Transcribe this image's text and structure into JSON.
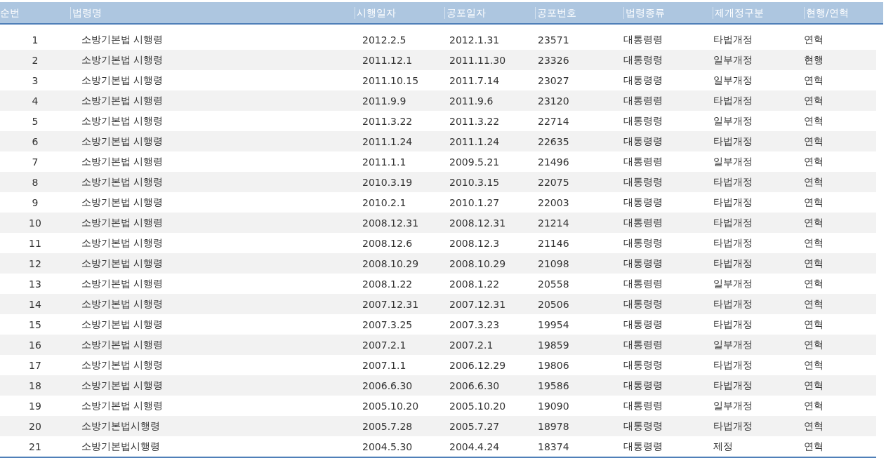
{
  "table": {
    "columns": [
      "순번",
      "법령명",
      "시행일자",
      "공포일자",
      "공포번호",
      "법령종류",
      "제개정구분",
      "현행/연혁"
    ],
    "rows": [
      [
        "1",
        "소방기본법 시행령",
        "2012.2.5",
        "2012.1.31",
        "23571",
        "대통령령",
        "타법개정",
        "연혁"
      ],
      [
        "2",
        "소방기본법 시행령",
        "2011.12.1",
        "2011.11.30",
        "23326",
        "대통령령",
        "일부개정",
        "현행"
      ],
      [
        "3",
        "소방기본법 시행령",
        "2011.10.15",
        "2011.7.14",
        "23027",
        "대통령령",
        "일부개정",
        "연혁"
      ],
      [
        "4",
        "소방기본법 시행령",
        "2011.9.9",
        "2011.9.6",
        "23120",
        "대통령령",
        "타법개정",
        "연혁"
      ],
      [
        "5",
        "소방기본법 시행령",
        "2011.3.22",
        "2011.3.22",
        "22714",
        "대통령령",
        "일부개정",
        "연혁"
      ],
      [
        "6",
        "소방기본법 시행령",
        "2011.1.24",
        "2011.1.24",
        "22635",
        "대통령령",
        "타법개정",
        "연혁"
      ],
      [
        "7",
        "소방기본법 시행령",
        "2011.1.1",
        "2009.5.21",
        "21496",
        "대통령령",
        "일부개정",
        "연혁"
      ],
      [
        "8",
        "소방기본법 시행령",
        "2010.3.19",
        "2010.3.15",
        "22075",
        "대통령령",
        "타법개정",
        "연혁"
      ],
      [
        "9",
        "소방기본법 시행령",
        "2010.2.1",
        "2010.1.27",
        "22003",
        "대통령령",
        "타법개정",
        "연혁"
      ],
      [
        "10",
        "소방기본법 시행령",
        "2008.12.31",
        "2008.12.31",
        "21214",
        "대통령령",
        "타법개정",
        "연혁"
      ],
      [
        "11",
        "소방기본법 시행령",
        "2008.12.6",
        "2008.12.3",
        "21146",
        "대통령령",
        "타법개정",
        "연혁"
      ],
      [
        "12",
        "소방기본법 시행령",
        "2008.10.29",
        "2008.10.29",
        "21098",
        "대통령령",
        "타법개정",
        "연혁"
      ],
      [
        "13",
        "소방기본법 시행령",
        "2008.1.22",
        "2008.1.22",
        "20558",
        "대통령령",
        "일부개정",
        "연혁"
      ],
      [
        "14",
        "소방기본법 시행령",
        "2007.12.31",
        "2007.12.31",
        "20506",
        "대통령령",
        "타법개정",
        "연혁"
      ],
      [
        "15",
        "소방기본법 시행령",
        "2007.3.25",
        "2007.3.23",
        "19954",
        "대통령령",
        "타법개정",
        "연혁"
      ],
      [
        "16",
        "소방기본법 시행령",
        "2007.2.1",
        "2007.2.1",
        "19859",
        "대통령령",
        "일부개정",
        "연혁"
      ],
      [
        "17",
        "소방기본법 시행령",
        "2007.1.1",
        "2006.12.29",
        "19806",
        "대통령령",
        "타법개정",
        "연혁"
      ],
      [
        "18",
        "소방기본법 시행령",
        "2006.6.30",
        "2006.6.30",
        "19586",
        "대통령령",
        "타법개정",
        "연혁"
      ],
      [
        "19",
        "소방기본법 시행령",
        "2005.10.20",
        "2005.10.20",
        "19090",
        "대통령령",
        "일부개정",
        "연혁"
      ],
      [
        "20",
        "소방기본법시행령",
        "2005.7.28",
        "2005.7.27",
        "18978",
        "대통령령",
        "타법개정",
        "연혁"
      ],
      [
        "21",
        "소방기본법시행령",
        "2004.5.30",
        "2004.4.24",
        "18374",
        "대통령령",
        "제정",
        "연혁"
      ]
    ]
  }
}
